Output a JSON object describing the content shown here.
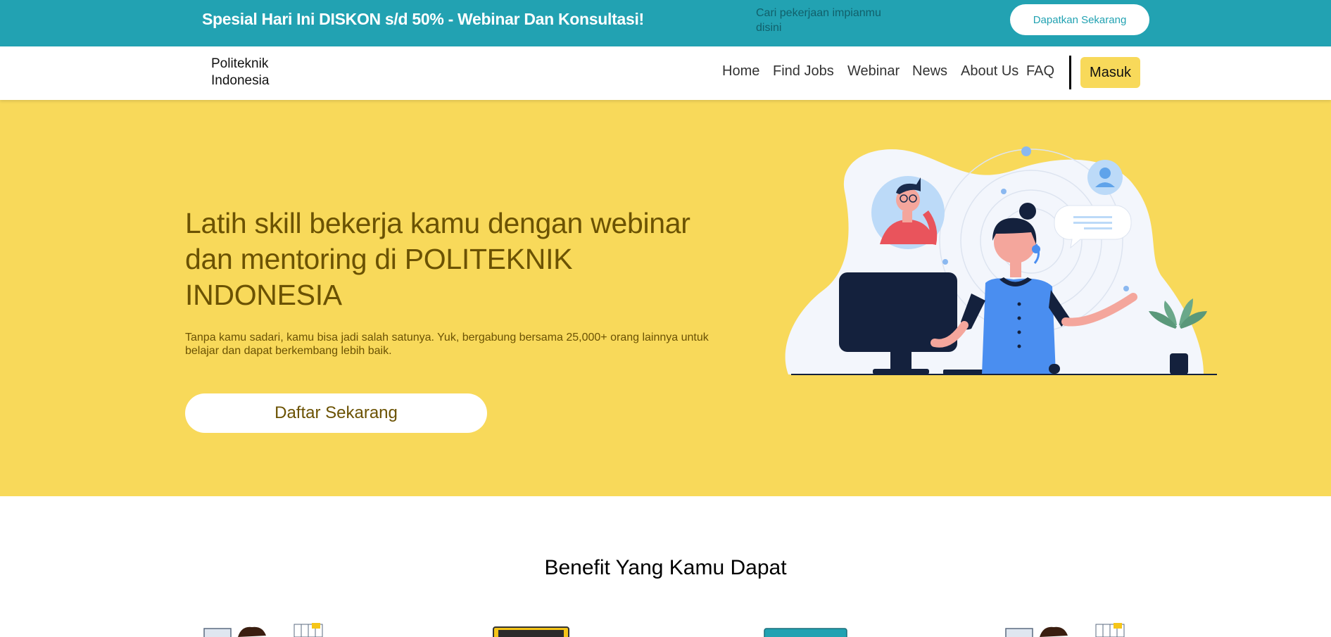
{
  "promo": {
    "text": "Spesial Hari Ini DISKON s/d 50% - Webinar Dan Konsultasi!",
    "search_placeholder": "Cari pekerjaan impianmu disini",
    "button_label": "Dapatkan Sekarang"
  },
  "navbar": {
    "brand": "Politeknik Indonesia",
    "links": [
      "Home",
      "Find Jobs",
      "Webinar",
      "News",
      "About Us",
      "FAQ"
    ],
    "login_label": "Masuk"
  },
  "hero": {
    "title": "Latih skill bekerja kamu dengan webinar dan mentoring di POLITEKNIK INDONESIA",
    "subtitle": "Tanpa kamu sadari, kamu bisa jadi salah satunya. Yuk, bergabung bersama 25,000+ orang lainnya untuk belajar dan dapat berkembang lebih baik.",
    "cta_label": "Daftar Sekarang",
    "illustration": "customer-support-illustration"
  },
  "benefit": {
    "title": "Benefit Yang Kamu Dapat",
    "icons": [
      "webinar-person-icon",
      "video-player-icon",
      "monitor-icon",
      "webinar-person-icon"
    ]
  },
  "colors": {
    "promo_bg": "#22a2b2",
    "hero_bg": "#f8d95a",
    "hero_text": "#6b5203",
    "login_button": "#f8d95a"
  }
}
